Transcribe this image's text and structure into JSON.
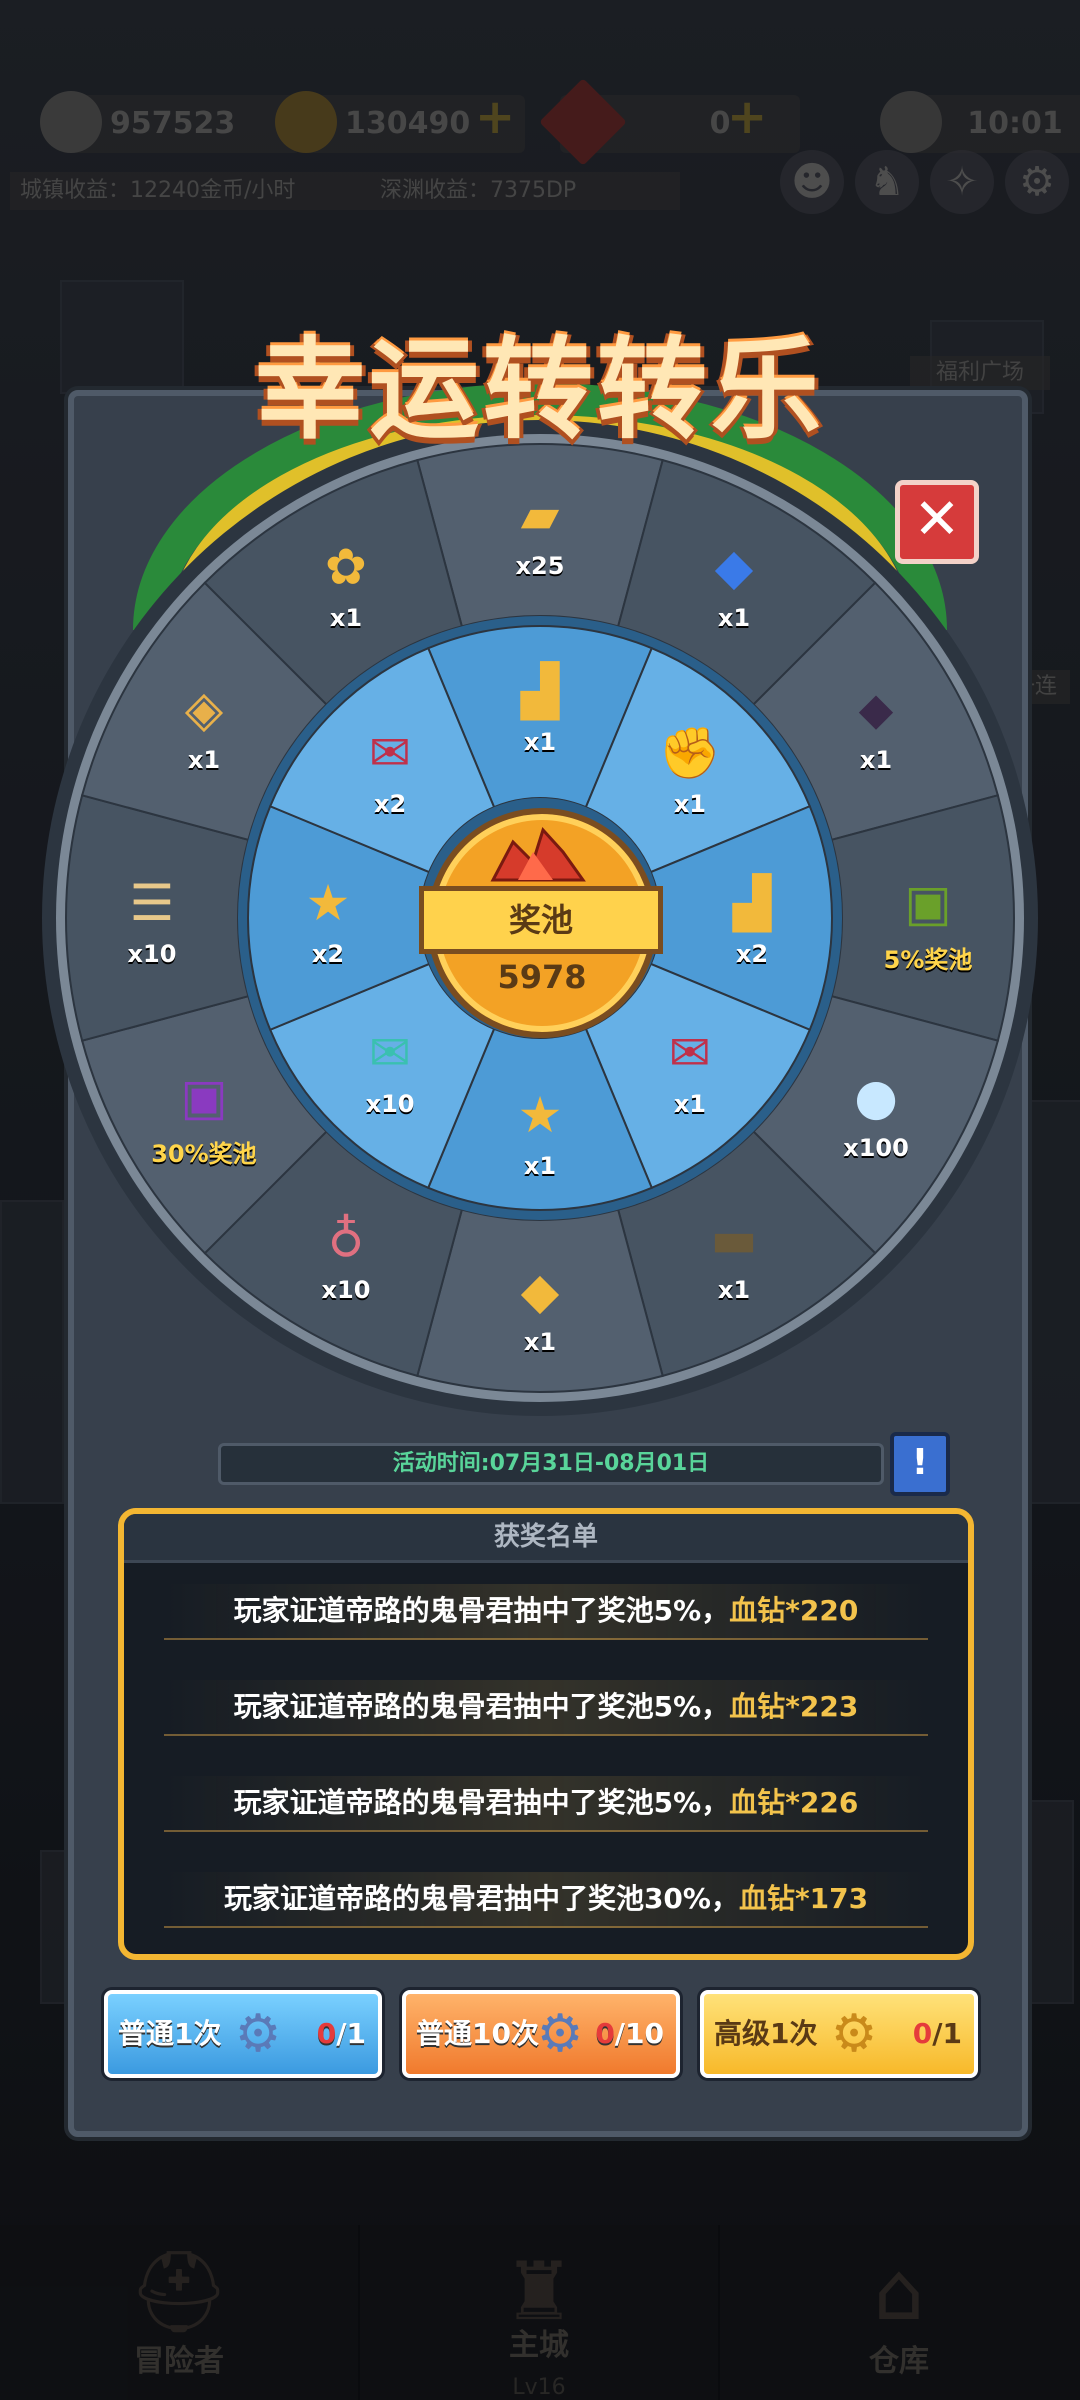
{
  "topbar": {
    "power_value": "957523",
    "gold_value": "130490",
    "gem_value": "0",
    "clock_value": "10:01",
    "town_income": "城镇收益：12240金币/小时",
    "abyss_income": "深渊收益：7375DP",
    "side_label_1": "福利广场",
    "side_label_2": "一连"
  },
  "wheel": {
    "title": "幸运转转乐",
    "outer_items": [
      {
        "icon": "gold-ingot-icon",
        "glyph": "▰",
        "qty": "x25"
      },
      {
        "icon": "blue-crystal-icon",
        "glyph": "◆",
        "qty": "x1"
      },
      {
        "icon": "dark-crystal-icon",
        "glyph": "⬥",
        "qty": "x1"
      },
      {
        "icon": "green-chest-icon",
        "glyph": "▣",
        "qty": "5%奖池"
      },
      {
        "icon": "rainbow-orb-icon",
        "glyph": "●",
        "qty": "x100"
      },
      {
        "icon": "cannon-icon",
        "glyph": "▬",
        "qty": "x1"
      },
      {
        "icon": "gold-ticket-icon",
        "glyph": "◆",
        "qty": "x1"
      },
      {
        "icon": "potion-bottle-icon",
        "glyph": "♁",
        "qty": "x10"
      },
      {
        "icon": "purple-chest-icon",
        "glyph": "▣",
        "qty": "30%奖池"
      },
      {
        "icon": "scroll-icon",
        "glyph": "☰",
        "qty": "x10"
      },
      {
        "icon": "tag-icon",
        "glyph": "◈",
        "qty": "x1"
      },
      {
        "icon": "gold-flower-icon",
        "glyph": "✿",
        "qty": "x1"
      }
    ],
    "inner_items": [
      {
        "icon": "gold-boot-icon",
        "glyph": "▟",
        "qty": "x1"
      },
      {
        "icon": "gold-gauntlet-icon",
        "glyph": "✊",
        "qty": "x1"
      },
      {
        "icon": "gold-boot-icon",
        "glyph": "▟",
        "qty": "x2"
      },
      {
        "icon": "red-envelope-icon",
        "glyph": "✉",
        "qty": "x1"
      },
      {
        "icon": "star-coin-icon",
        "glyph": "★",
        "qty": "x1"
      },
      {
        "icon": "teal-envelope-icon",
        "glyph": "✉",
        "qty": "x10"
      },
      {
        "icon": "star-coin-icon",
        "glyph": "★",
        "qty": "x2"
      },
      {
        "icon": "red-envelope-icon",
        "glyph": "✉",
        "qty": "x2"
      }
    ],
    "pool_label": "奖池",
    "pool_amount": "5978",
    "close_glyph": "✕"
  },
  "event": {
    "time_text": "活动时间:07月31日-08月01日",
    "info_glyph": "!"
  },
  "winners": {
    "title": "获奖名单",
    "rows": [
      {
        "text": "玩家证道帝路的鬼骨君抽中了奖池5%，",
        "reward": "血钻*220"
      },
      {
        "text": "玩家证道帝路的鬼骨君抽中了奖池5%，",
        "reward": "血钻*223"
      },
      {
        "text": "玩家证道帝路的鬼骨君抽中了奖池5%，",
        "reward": "血钻*226"
      },
      {
        "text": "玩家证道帝路的鬼骨君抽中了奖池30%，",
        "reward": "血钻*173"
      }
    ]
  },
  "buttons": [
    {
      "label": "普通1次",
      "used": "0",
      "total": "/1",
      "ticket_icon": "blue-gear-ticket-icon"
    },
    {
      "label": "普通10次",
      "used": "0",
      "total": "/10",
      "ticket_icon": "blue-gear-ticket-icon"
    },
    {
      "label": "高级1次",
      "used": "0",
      "total": "/1",
      "ticket_icon": "gold-gear-ticket-icon"
    }
  ],
  "nav": [
    {
      "label": "冒险者",
      "sub": ""
    },
    {
      "label": "主城",
      "sub": "Lv16"
    },
    {
      "label": "仓库",
      "sub": ""
    }
  ],
  "colors": {
    "accent_gold": "#f3b632",
    "inner_ring": "#4a9ad8",
    "outer_ring": "#4c5a6a",
    "reward_text": "#f3c34c",
    "time_text": "#59d59a"
  }
}
